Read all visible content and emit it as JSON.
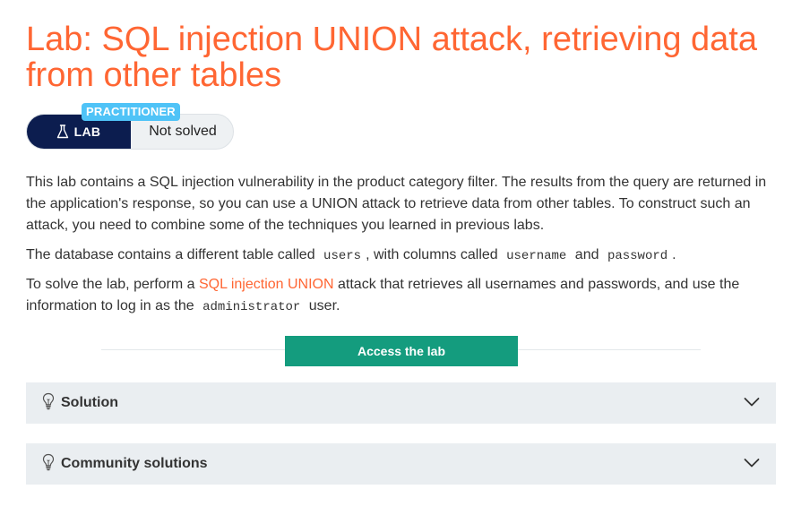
{
  "page": {
    "title": "Lab: SQL injection UNION attack, retrieving data from other tables"
  },
  "lab_badge": {
    "level": "PRACTITIONER",
    "type_label": "LAB",
    "status": "Not solved",
    "icon": "flask-icon"
  },
  "description": {
    "p1": "This lab contains a SQL injection vulnerability in the product category filter. The results from the query are returned in the application's response, so you can use a UNION attack to retrieve data from other tables. To construct such an attack, you need to combine some of the techniques you learned in previous labs.",
    "p2_before": "The database contains a different table called ",
    "p2_table": "users",
    "p2_mid1": ", with columns called ",
    "p2_col1": "username",
    "p2_mid2": " and ",
    "p2_col2": "password",
    "p2_end": ".",
    "p3_before": "To solve the lab, perform a ",
    "p3_link": "SQL injection UNION",
    "p3_mid": " attack that retrieves all usernames and passwords, and use the information to log in as the ",
    "p3_user": "administrator",
    "p3_end": " user."
  },
  "access_button": {
    "label": "Access the lab"
  },
  "accordions": [
    {
      "label": "Solution",
      "icon": "lightbulb-icon",
      "expand_icon": "chevron-down-icon"
    },
    {
      "label": "Community solutions",
      "icon": "lightbulb-icon",
      "expand_icon": "chevron-down-icon"
    }
  ],
  "colors": {
    "title": "#ff6633",
    "link": "#ff6633",
    "lab_dark": "#0c1d4f",
    "level_badge": "#4fc3f7",
    "button": "#149c7e",
    "accordion_bg": "#eaeef1"
  }
}
